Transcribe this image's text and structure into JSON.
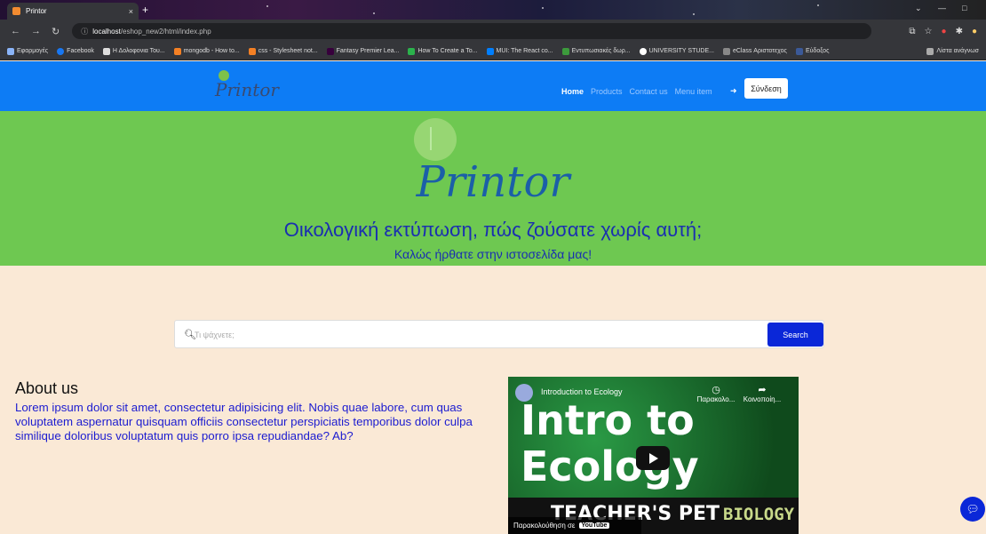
{
  "browser": {
    "tab_title": "Printor",
    "tab_close": "×",
    "new_tab": "+",
    "url_host": "localhost",
    "url_path": "/eshop_new2/html/index.php",
    "bookmarks": [
      "Εφαρμογές",
      "Facebook",
      "Η Δολοφονια Του...",
      "mongodb - How to...",
      "css - Stylesheet not...",
      "Fantasy Premier Lea...",
      "How To Create a To...",
      "MUI: The React co...",
      "Εντυπωσιακές δωρ...",
      "UNIVERSITY STUDE...",
      "eClass Αριστοτεχος",
      "Εύδοξος"
    ],
    "reading_list": "Λίστα ανάγνωσ"
  },
  "navbar": {
    "logo_text": "Printor",
    "links": [
      "Home",
      "Products",
      "Contact us",
      "Menu item"
    ],
    "login_label": "Σύνδεση"
  },
  "hero": {
    "title": "Printor",
    "subtitle": "Οικολογική εκτύπωση, πώς ζούσατε χωρίς αυτή;",
    "welcome": "Καλώς ήρθατε στην ιστοσελίδα μας!"
  },
  "search": {
    "placeholder": "Τι ψάχνετε;",
    "button_label": "Search"
  },
  "about": {
    "heading": "About us",
    "text": "Lorem ipsum dolor sit amet, consectetur adipisicing elit. Nobis quae labore, cum quas voluptatem aspernatur quisquam officiis consectetur perspiciatis temporibus dolor culpa similique doloribus voluptatum quis porro ipsa repudiandae? Ab?"
  },
  "video": {
    "title": "Introduction to Ecology",
    "big_line1": "Intro to",
    "big_line2": "Ecology",
    "watch_later": "Παρακολο...",
    "share": "Κοινοποίη...",
    "teacher": "TEACHER'S PET",
    "subject": "BIOLOGY",
    "watch_on": "Παρακολούθηση σε",
    "youtube": "YouTube"
  },
  "colors": {
    "navbar": "#0d7cf5",
    "hero": "#6ec851",
    "page_bg": "#fae9d6",
    "search_button": "#0a27d8"
  }
}
